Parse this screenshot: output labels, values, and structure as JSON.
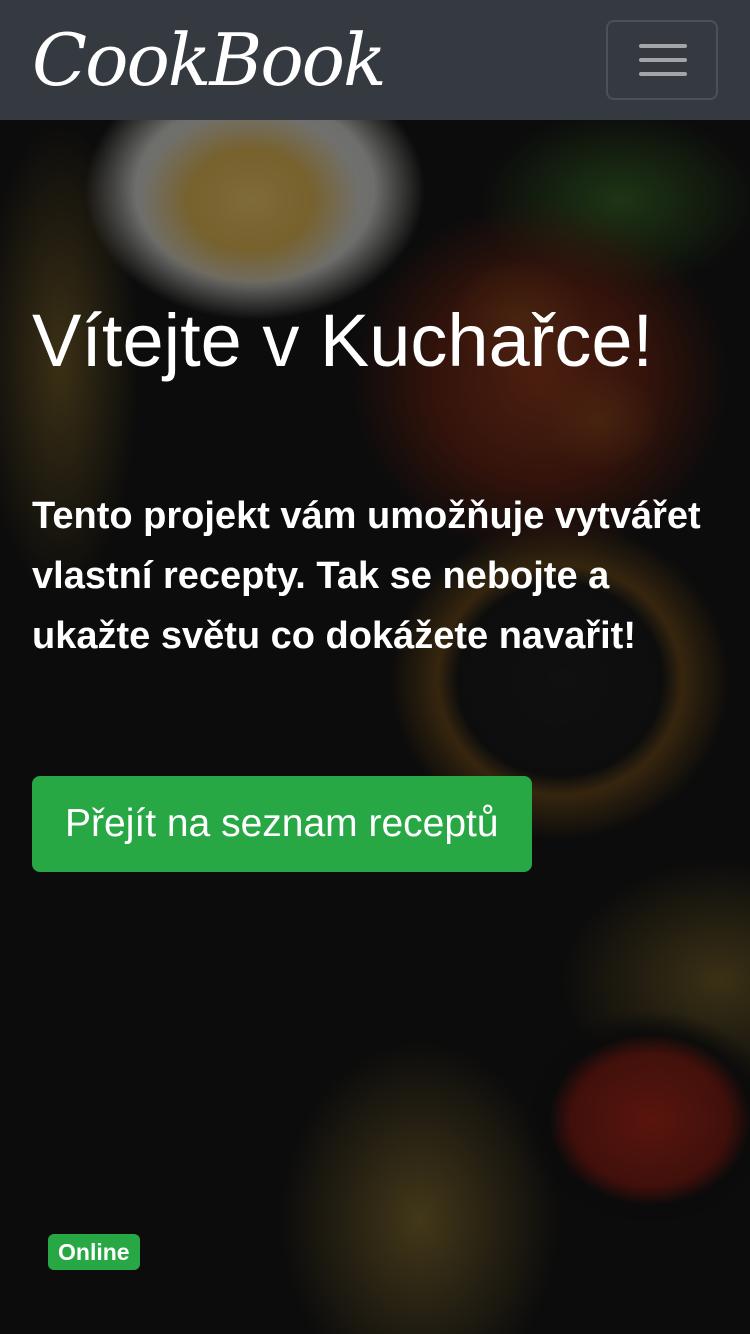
{
  "navbar": {
    "brand": "CookBook",
    "toggle_icon": "hamburger-menu-icon"
  },
  "hero": {
    "title": "Vítejte v Kuchařce!",
    "text": "Tento projekt vám umožňuje vytvářet vlastní recepty. Tak se nebojte a ukažte světu co dokážete navařit!",
    "button_label": "Přejít na seznam receptů"
  },
  "status": {
    "label": "Online",
    "color": "#28a745"
  },
  "colors": {
    "navbar": "#343a40",
    "accent": "#28a745"
  }
}
